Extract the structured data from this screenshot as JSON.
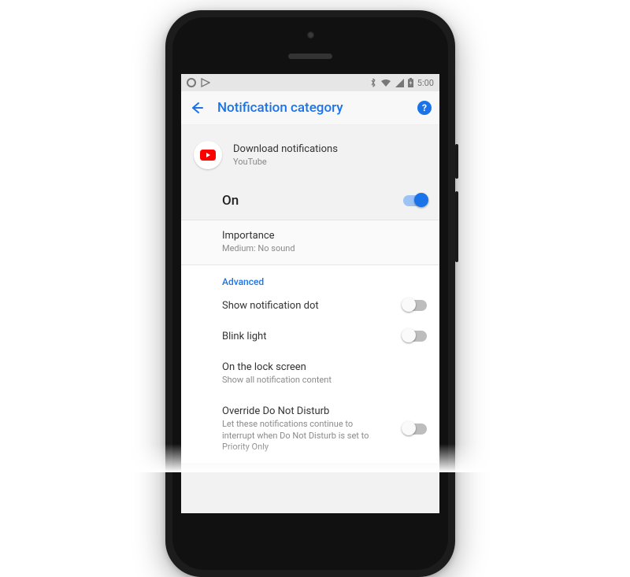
{
  "status": {
    "time": "5:00"
  },
  "appbar": {
    "title": "Notification category"
  },
  "channel": {
    "title": "Download notifications",
    "app_name": "YouTube"
  },
  "master": {
    "label": "On",
    "enabled": true
  },
  "importance": {
    "title": "Importance",
    "value": "Medium: No sound"
  },
  "advanced": {
    "header": "Advanced",
    "dot": {
      "title": "Show notification dot",
      "enabled": false
    },
    "blink": {
      "title": "Blink light",
      "enabled": false
    },
    "lock": {
      "title": "On the lock screen",
      "value": "Show all notification content"
    },
    "dnd": {
      "title": "Override Do Not Disturb",
      "desc": "Let these notifications continue to interrupt when Do Not Disturb is set to Priority Only",
      "enabled": false
    }
  },
  "colors": {
    "accent": "#1a73e8"
  }
}
